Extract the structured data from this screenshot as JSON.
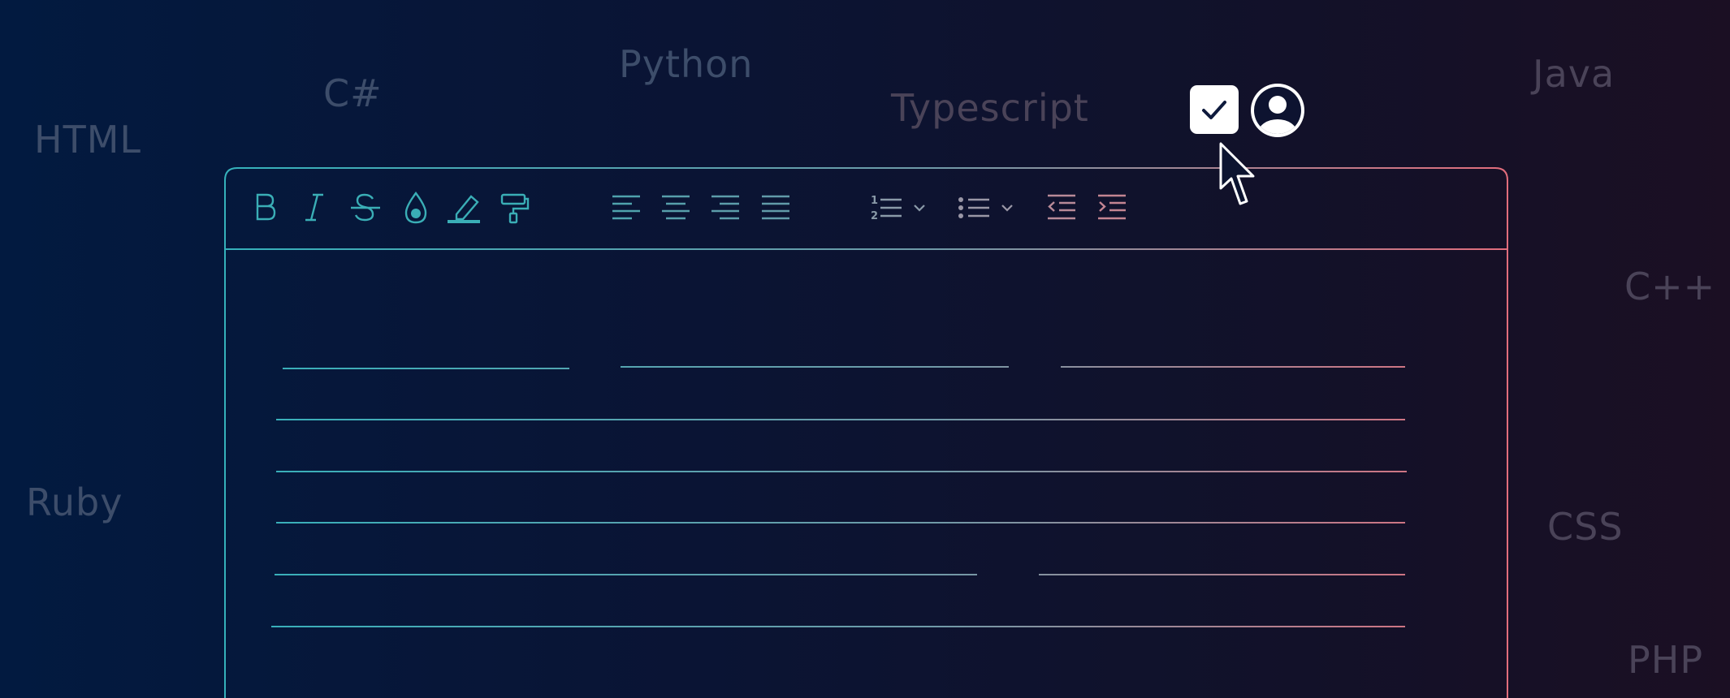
{
  "languages": {
    "html": "HTML",
    "csharp": "C#",
    "python": "Python",
    "typescript": "Typescript",
    "java": "Java",
    "cpp": "C++",
    "ruby": "Ruby",
    "css": "CSS",
    "php": "PHP"
  },
  "toolbar": {
    "icons": [
      "bold-icon",
      "italic-icon",
      "strikethrough-icon",
      "text-color-icon",
      "highlight-icon",
      "format-painter-icon",
      "align-left-icon",
      "align-center-icon",
      "align-right-icon",
      "align-justify-icon",
      "numbered-list-icon",
      "bulleted-list-icon",
      "outdent-icon",
      "indent-icon"
    ]
  },
  "colors": {
    "accent_teal": "#3aaeb6",
    "accent_pink": "#e0707f",
    "background_left": "#021a40",
    "background_right": "#1b0f23",
    "muted_text": "#3d4d6a"
  },
  "overlay_icons": [
    "checkbox-checked-icon",
    "user-avatar-icon",
    "mouse-pointer-icon"
  ]
}
